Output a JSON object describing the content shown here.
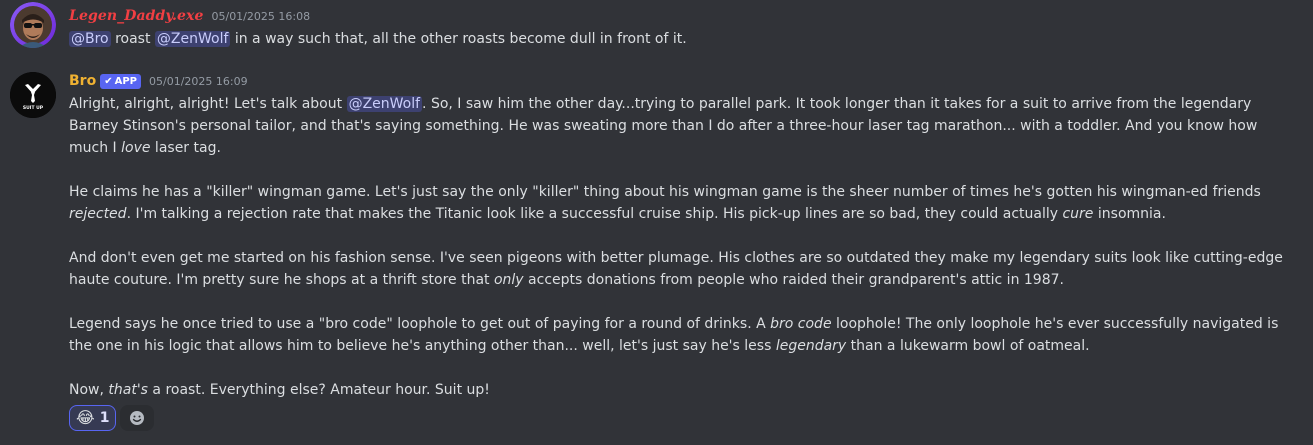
{
  "messages": [
    {
      "author": "Legen_Daddy.exe",
      "timestamp": "05/01/2025 16:08",
      "avatar_icon": "user-photo-avatar",
      "mention_1": "@Bro",
      "text_1": " roast ",
      "mention_2": "@ZenWolf",
      "text_2": " in a way such that, all the other roasts become dull in front of it."
    },
    {
      "author": "Bro",
      "badge": "APP",
      "timestamp": "05/01/2025 16:09",
      "avatar_icon": "suit-up-logo",
      "avatar_text": "SUIT UP",
      "p1": {
        "a": "Alright, alright, alright!  Let's talk about ",
        "mention": "@ZenWolf",
        "b": ".  So, I saw him the other day...trying to parallel park.  It took longer than it takes for a suit to arrive from the legendary Barney Stinson's personal tailor, and that's saying something.  He was sweating more than I do after a three-hour laser tag marathon... with a toddler.  And you know how much I ",
        "em1": "love",
        "c": " laser tag."
      },
      "p2": {
        "a": "He claims he has a \"killer\" wingman game.  Let's just say the only \"killer\" thing about his wingman game is the sheer number of times he's gotten his wingman-ed friends ",
        "em1": "rejected",
        "b": ". I'm talking a rejection rate that makes the Titanic look like a successful cruise ship.  His pick-up lines are so bad, they could actually ",
        "em2": "cure",
        "c": " insomnia."
      },
      "p3": {
        "a": "And don't even get me started on his fashion sense.  I've seen pigeons with better plumage. His clothes are so outdated they make my legendary suits look like cutting-edge haute couture.  I'm pretty sure he shops at a thrift store that ",
        "em1": "only",
        "b": " accepts donations from people who raided their grandparent's attic in 1987."
      },
      "p4": {
        "a": "Legend says he once tried to use a \"bro code\" loophole to get out of paying for a round of drinks.  A ",
        "em1": "bro code",
        "b": " loophole!  The only loophole he's ever successfully navigated is the one in his logic that allows him to believe he's anything other than... well, let's just say he's less ",
        "em2": "legendary",
        "c": " than a lukewarm bowl of oatmeal."
      },
      "p5": {
        "a": "Now, ",
        "em1": "that's",
        "b": " a roast.  Everything else?  Amateur hour.  Suit up!"
      },
      "reactions": [
        {
          "emoji": "😂",
          "emoji_name": "joy-emoji",
          "count": "1"
        }
      ],
      "add_reaction_icon": "add-reaction-smiley-icon"
    }
  ],
  "colors": {
    "background": "#313338",
    "legen_name": "#f23f43",
    "bro_name": "#f0b232",
    "mention_bg": "rgba(88,101,242,0.3)",
    "app_badge": "#5865f2"
  }
}
